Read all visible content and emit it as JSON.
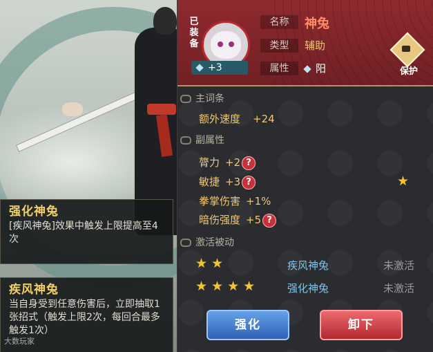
{
  "left": {
    "tooltip1": {
      "title": "强化神兔",
      "desc": "[疾风神兔]效果中触发上限提高至4次"
    },
    "tooltip2": {
      "title": "疾风神兔",
      "desc": "当自身受到任意伤害后，立即抽取1张招式（触发上限2次，每回合最多触发1次）"
    },
    "watermark": "大数玩家"
  },
  "card": {
    "equipped": "已装备",
    "level": "+3",
    "name_label": "名称",
    "name": "神兔",
    "type_label": "类型",
    "type": "辅助",
    "attr_label": "属性",
    "attr": "阳",
    "protect": "保护"
  },
  "main_stat": {
    "header": "主词条",
    "name": "额外速度",
    "value": "+24"
  },
  "sub_stats": {
    "header": "副属性",
    "items": [
      {
        "name": "膂力",
        "value": "+2",
        "help": "?"
      },
      {
        "name": "敏捷",
        "value": "+3",
        "help": "?"
      },
      {
        "name": "拳掌伤害",
        "value": "+1%"
      },
      {
        "name": "暗伤强度",
        "value": "+5",
        "help": "?"
      }
    ]
  },
  "passives": {
    "header": "激活被动",
    "items": [
      {
        "stars": 2,
        "name": "疾风神兔",
        "state": "未激活"
      },
      {
        "stars": 4,
        "name": "强化神兔",
        "state": "未激活"
      }
    ]
  },
  "buttons": {
    "enhance": "强化",
    "unequip": "卸下"
  },
  "colors": {
    "gold": "#f1c872",
    "passive_blue": "#7ac7ee",
    "header_red": "#8e2a2f"
  }
}
